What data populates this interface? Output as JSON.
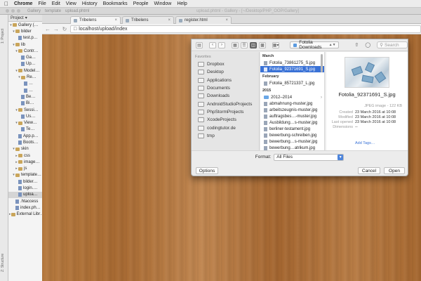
{
  "menubar": {
    "app_name": "Chrome",
    "items": [
      "File",
      "Edit",
      "View",
      "History",
      "Bookmarks",
      "People",
      "Window",
      "Help"
    ]
  },
  "ide": {
    "window_title": "upload.phtml - Gallery - [~/Desktop/PHP_OOP/Gallery]",
    "breadcrumb_root": "Gallery",
    "breadcrumb_mid": "template",
    "breadcrumb_file": "upload.phtml",
    "project_label": "Project",
    "left_tab_project": "1: Project",
    "left_tab_structure": "Z: Structure",
    "tree": [
      {
        "label": "Gallery (…",
        "indent": 0,
        "arrow": "▾",
        "icon": "folder"
      },
      {
        "label": "bilder",
        "indent": 1,
        "arrow": "▾",
        "icon": "folder"
      },
      {
        "label": "test.p…",
        "indent": 2,
        "arrow": "",
        "icon": "file"
      },
      {
        "label": "lib",
        "indent": 1,
        "arrow": "▾",
        "icon": "folder"
      },
      {
        "label": "Contr…",
        "indent": 2,
        "arrow": "▾",
        "icon": "folder"
      },
      {
        "label": "Ga…",
        "indent": 3,
        "arrow": "",
        "icon": "file"
      },
      {
        "label": "Up…",
        "indent": 3,
        "arrow": "",
        "icon": "file"
      },
      {
        "label": "Model…",
        "indent": 2,
        "arrow": "▾",
        "icon": "folder"
      },
      {
        "label": "Re…",
        "indent": 3,
        "arrow": "▾",
        "icon": "folder"
      },
      {
        "label": "…",
        "indent": 4,
        "arrow": "",
        "icon": "file"
      },
      {
        "label": "…",
        "indent": 4,
        "arrow": "",
        "icon": "file"
      },
      {
        "label": "Be…",
        "indent": 3,
        "arrow": "",
        "icon": "file"
      },
      {
        "label": "Bi…",
        "indent": 3,
        "arrow": "",
        "icon": "file"
      },
      {
        "label": "Sessi…",
        "indent": 2,
        "arrow": "▾",
        "icon": "folder"
      },
      {
        "label": "Us…",
        "indent": 3,
        "arrow": "",
        "icon": "file"
      },
      {
        "label": "View…",
        "indent": 2,
        "arrow": "▾",
        "icon": "folder"
      },
      {
        "label": "Te…",
        "indent": 3,
        "arrow": "",
        "icon": "file"
      },
      {
        "label": "App.p…",
        "indent": 2,
        "arrow": "",
        "icon": "file"
      },
      {
        "label": "Boots…",
        "indent": 2,
        "arrow": "",
        "icon": "file"
      },
      {
        "label": "skin",
        "indent": 1,
        "arrow": "▾",
        "icon": "folder"
      },
      {
        "label": "css",
        "indent": 2,
        "arrow": "▸",
        "icon": "folder"
      },
      {
        "label": "image…",
        "indent": 2,
        "arrow": "▸",
        "icon": "folder"
      },
      {
        "label": "js",
        "indent": 2,
        "arrow": "▸",
        "icon": "folder"
      },
      {
        "label": "template…",
        "indent": 1,
        "arrow": "▾",
        "icon": "folder"
      },
      {
        "label": "bilder…",
        "indent": 2,
        "arrow": "",
        "icon": "file"
      },
      {
        "label": "login.…",
        "indent": 2,
        "arrow": "",
        "icon": "file"
      },
      {
        "label": "uploa…",
        "indent": 2,
        "arrow": "",
        "icon": "file",
        "selected": true
      },
      {
        "label": ".htaccess",
        "indent": 1,
        "arrow": "",
        "icon": "file"
      },
      {
        "label": "index.ph…",
        "indent": 1,
        "arrow": "",
        "icon": "file"
      },
      {
        "label": "External Libr…",
        "indent": 0,
        "arrow": "▸",
        "icon": "folder"
      }
    ]
  },
  "browser": {
    "tabs": [
      {
        "label": "Tribelens",
        "active": true
      },
      {
        "label": "Tribelens",
        "active": false
      },
      {
        "label": "register.html",
        "active": false
      }
    ],
    "url": "localhost/upload/index"
  },
  "dialog": {
    "location": "Fotolia Downloads",
    "search_placeholder": "Search",
    "favorites_heading": "Favorites",
    "favorites": [
      "Dropbox",
      "Desktop",
      "Applications",
      "Documents",
      "Downloads",
      "AndroidStudioProjects",
      "PhpStormProjects",
      "XcodeProjects",
      "codingtutor.de",
      "tmp"
    ],
    "sections": [
      {
        "heading": "March",
        "rows": [
          {
            "label": "Fotolia_73861275_S.jpg",
            "type": "file",
            "selected": false
          },
          {
            "label": "Fotolia_92371691_S.jpg",
            "type": "file",
            "selected": true
          }
        ]
      },
      {
        "heading": "February",
        "rows": [
          {
            "label": "Fotolia_85721337_L.jpg",
            "type": "file",
            "selected": false
          }
        ]
      },
      {
        "heading": "2015",
        "rows": [
          {
            "label": "2012–2014",
            "type": "folder",
            "selected": false
          },
          {
            "label": "abmahnung-muster.jpg",
            "type": "file",
            "selected": false
          },
          {
            "label": "arbeitszeugnis-muster.jpg",
            "type": "file",
            "selected": false
          },
          {
            "label": "auftragsbes…-muster.jpg",
            "type": "file",
            "selected": false
          },
          {
            "label": "Ausbildung…s-muster.jpg",
            "type": "file",
            "selected": false
          },
          {
            "label": "berliner-testament.jpg",
            "type": "file",
            "selected": false
          },
          {
            "label": "bewerbung-schreiben.jpg",
            "type": "file",
            "selected": false
          },
          {
            "label": "bewerbung…s-muster.jpg",
            "type": "file",
            "selected": false
          },
          {
            "label": "bewerbung…atrikum.jpg",
            "type": "file",
            "selected": false
          }
        ]
      }
    ],
    "preview": {
      "name": "Fotolia_92371691_S.jpg",
      "kind": "JPEG image - 122 KB",
      "meta": [
        {
          "key": "Created",
          "value": "23 March 2016 at 10:08"
        },
        {
          "key": "Modified",
          "value": "23 March 2016 at 10:08"
        },
        {
          "key": "Last opened",
          "value": "23 March 2016 at 10:08"
        },
        {
          "key": "Dimensions",
          "value": "--"
        }
      ],
      "add_tags": "Add Tags…"
    },
    "format_label": "Format:",
    "format_value": "All Files",
    "options_label": "Options",
    "cancel_label": "Cancel",
    "open_label": "Open"
  }
}
